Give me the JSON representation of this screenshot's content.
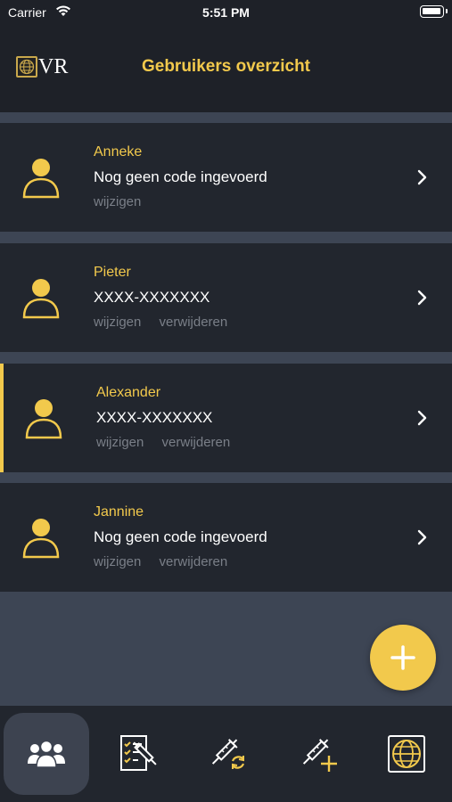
{
  "status_bar": {
    "carrier": "Carrier",
    "time": "5:51 PM"
  },
  "nav": {
    "logo_text": "VR",
    "title": "Gebruikers overzicht"
  },
  "users": [
    {
      "name": "Anneke",
      "code": "Nog geen code ingevoerd",
      "actions": [
        "wijzigen"
      ],
      "active": false
    },
    {
      "name": "Pieter",
      "code": "XXXX-XXXXXXX",
      "actions": [
        "wijzigen",
        "verwijderen"
      ],
      "active": false
    },
    {
      "name": "Alexander",
      "code": "XXXX-XXXXXXX",
      "actions": [
        "wijzigen",
        "verwijderen"
      ],
      "active": true
    },
    {
      "name": "Jannine",
      "code": "Nog geen code ingevoerd",
      "actions": [
        "wijzigen",
        "verwijderen"
      ],
      "active": false
    }
  ],
  "tabs": [
    {
      "icon": "users-icon",
      "selected": true
    },
    {
      "icon": "checklist-syringe-icon",
      "selected": false
    },
    {
      "icon": "syringe-refresh-icon",
      "selected": false
    },
    {
      "icon": "syringe-add-icon",
      "selected": false
    },
    {
      "icon": "globe-icon",
      "selected": false
    }
  ],
  "colors": {
    "accent": "#f2c94c",
    "card": "#22262e",
    "background": "#3d4554",
    "muted": "#7a7f88"
  }
}
